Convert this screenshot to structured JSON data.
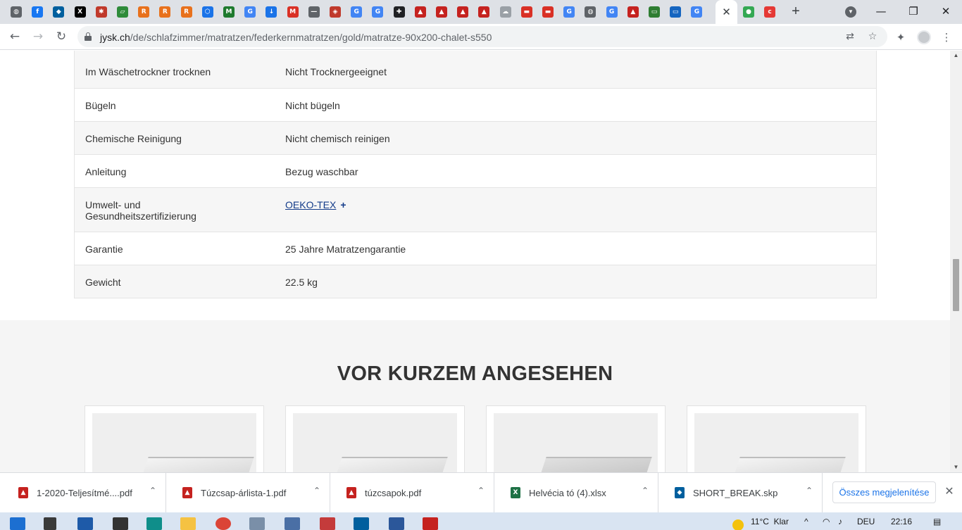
{
  "browser": {
    "tabs": [
      {
        "icon": "globe-icon",
        "color": "#5f6368"
      },
      {
        "icon": "facebook-icon",
        "color": "#1877f2"
      },
      {
        "icon": "sketchup-icon",
        "color": "#005f9e"
      },
      {
        "icon": "x-icon",
        "color": "#000000"
      },
      {
        "icon": "seal-icon",
        "color": "#c0392b"
      },
      {
        "icon": "green-icon",
        "color": "#2e8b3a"
      },
      {
        "icon": "r-icon",
        "color": "#e8711c"
      },
      {
        "icon": "r-icon",
        "color": "#e8711c"
      },
      {
        "icon": "r-icon",
        "color": "#e8711c"
      },
      {
        "icon": "hex-icon",
        "color": "#1a73e8"
      },
      {
        "icon": "mno-icon",
        "color": "#1e7a2e"
      },
      {
        "icon": "google-icon",
        "color": "#4285f4"
      },
      {
        "icon": "download-icon",
        "color": "#1a73e8"
      },
      {
        "icon": "gmail-icon",
        "color": "#d93025"
      },
      {
        "icon": "line-icon",
        "color": "#5f6368"
      },
      {
        "icon": "shield-icon",
        "color": "#c0392b"
      },
      {
        "icon": "google-icon",
        "color": "#4285f4"
      },
      {
        "icon": "google-icon",
        "color": "#4285f4"
      },
      {
        "icon": "puzzle-icon",
        "color": "#202124"
      },
      {
        "icon": "pdf-icon",
        "color": "#c5221f"
      },
      {
        "icon": "pdf-icon",
        "color": "#c5221f"
      },
      {
        "icon": "pdf-icon",
        "color": "#c5221f"
      },
      {
        "icon": "pdf-icon",
        "color": "#c5221f"
      },
      {
        "icon": "cloud-icon",
        "color": "#9aa0a6"
      },
      {
        "icon": "news-icon",
        "color": "#d93025"
      },
      {
        "icon": "news-icon",
        "color": "#d93025"
      },
      {
        "icon": "google-icon",
        "color": "#4285f4"
      },
      {
        "icon": "globe-icon",
        "color": "#5f6368"
      },
      {
        "icon": "google-icon",
        "color": "#4285f4"
      },
      {
        "icon": "pdf-icon",
        "color": "#c5221f"
      },
      {
        "icon": "card-icon",
        "color": "#2e7d32"
      },
      {
        "icon": "card-icon",
        "color": "#1565c0"
      },
      {
        "icon": "google-icon",
        "color": "#4285f4"
      }
    ],
    "active_tab_icon": "close-icon",
    "after_active_tabs": [
      {
        "icon": "maps-icon",
        "color": "#34a853"
      },
      {
        "icon": "cardo-icon",
        "color": "#e53935"
      }
    ],
    "url_host": "jysk.ch",
    "url_path": "/de/schlafzimmer/matratzen/federkernmatratzen/gold/matratze-90x200-chalet-s550"
  },
  "specs": [
    {
      "label": "Im Wäschetrockner trocknen",
      "value": "Nicht Trocknergeeignet",
      "alt": true
    },
    {
      "label": "Bügeln",
      "value": "Nicht bügeln",
      "alt": false
    },
    {
      "label": "Chemische Reinigung",
      "value": "Nicht chemisch reinigen",
      "alt": true
    },
    {
      "label": "Anleitung",
      "value": "Bezug waschbar",
      "alt": false
    },
    {
      "label": "Umwelt- und Gesundheitszertifizierung",
      "value": "OEKO-TEX",
      "link": true,
      "plus": "+",
      "alt": true
    },
    {
      "label": "Garantie",
      "value": "25 Jahre Matratzengarantie",
      "alt": false
    },
    {
      "label": "Gewicht",
      "value": "22.5 kg",
      "alt": true
    }
  ],
  "recent": {
    "title": "VOR KURZEM ANGESEHEN"
  },
  "downloads": [
    {
      "name": "1-2020-Teljesítmé....pdf",
      "type": "pdf"
    },
    {
      "name": "Túzcsap-árlista-1.pdf",
      "type": "pdf"
    },
    {
      "name": "túzcsapok.pdf",
      "type": "pdf"
    },
    {
      "name": "Helvécia tó (4).xlsx",
      "type": "xlsx"
    },
    {
      "name": "SHORT_BREAK.skp",
      "type": "skp"
    }
  ],
  "show_all_label": "Összes megjelenítése",
  "taskbar": {
    "temperature": "11°C",
    "weather": "Klar",
    "language": "DEU",
    "time": "22:16"
  }
}
